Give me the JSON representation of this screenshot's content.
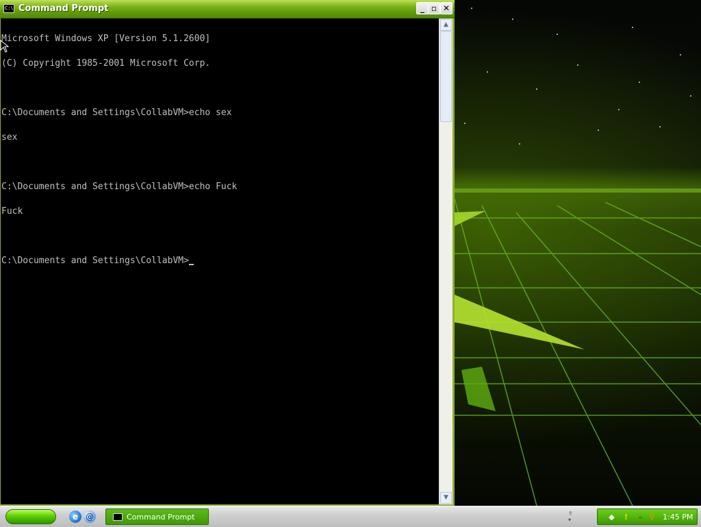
{
  "window": {
    "title": "Command Prompt",
    "title_icon": "C:\\",
    "minimize_label": "_",
    "maximize_label": "▫",
    "close_label": "✕"
  },
  "console": {
    "lines": [
      "Microsoft Windows XP [Version 5.1.2600]",
      "(C) Copyright 1985-2001 Microsoft Corp.",
      "",
      "C:\\Documents and Settings\\CollabVM>echo sex",
      "sex",
      "",
      "C:\\Documents and Settings\\CollabVM>echo Fuck",
      "Fuck",
      "",
      "C:\\Documents and Settings\\CollabVM>"
    ]
  },
  "scrollbar": {
    "up_glyph": "▲",
    "down_glyph": "▼"
  },
  "taskbar": {
    "task_label": "Command Prompt",
    "clock": "1:45 PM",
    "quicklaunch": [
      "internet-explorer-icon",
      "show-desktop-icon"
    ],
    "tray_icons": [
      "network-icon",
      "security-shield-icon",
      "volume-icon",
      "search-icon"
    ]
  },
  "colors": {
    "title_green": "#5e9a0c",
    "console_bg": "#000000",
    "console_text": "#c0c0c0",
    "start_green": "#5fd000"
  }
}
